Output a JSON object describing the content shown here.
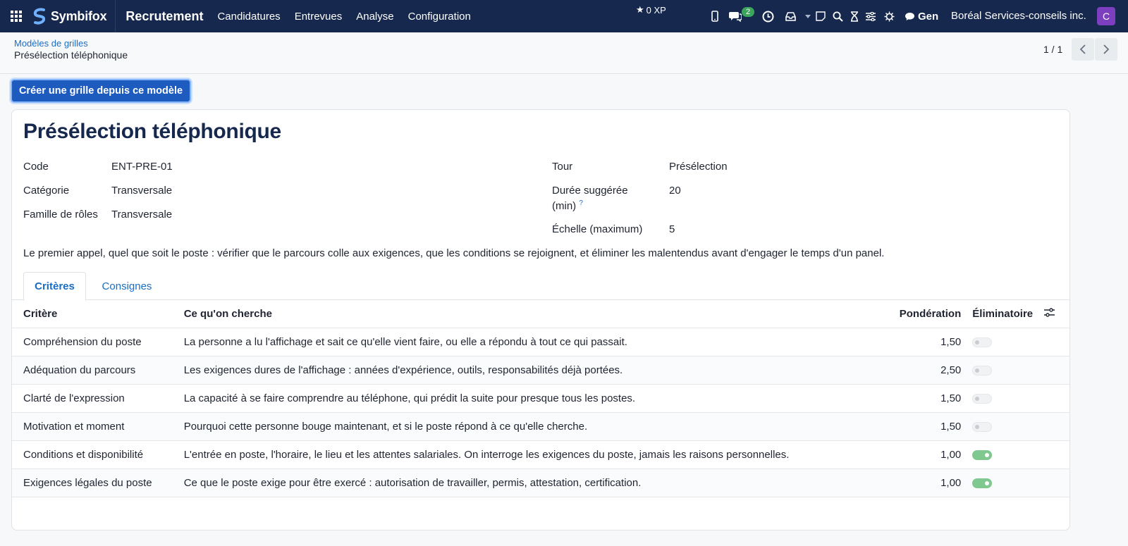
{
  "navbar": {
    "brand": "Symbifox",
    "app_title": "Recrutement",
    "menu": [
      "Candidatures",
      "Entrevues",
      "Analyse",
      "Configuration"
    ],
    "xp": "0 XP",
    "chat_badge": "2",
    "lang": "Gen",
    "company": "Boréal Services-conseils inc.",
    "avatar_letter": "C"
  },
  "breadcrumb": {
    "parent": "Modèles de grilles",
    "current": "Présélection téléphonique"
  },
  "pager": {
    "value": "1 / 1"
  },
  "actions": {
    "create_label": "Créer une grille depuis ce modèle"
  },
  "form": {
    "title": "Présélection téléphonique",
    "left_fields": [
      {
        "label": "Code",
        "value": "ENT-PRE-01"
      },
      {
        "label": "Catégorie",
        "value": "Transversale"
      },
      {
        "label": "Famille de rôles",
        "value": "Transversale"
      }
    ],
    "right_fields": [
      {
        "label": "Tour",
        "value": "Présélection"
      },
      {
        "label_line1": "Durée suggérée",
        "label_line2": "(min)",
        "help": "?",
        "value": "20"
      },
      {
        "label": "Échelle (maximum)",
        "value": "5"
      }
    ],
    "description": "Le premier appel, quel que soit le poste : vérifier que le parcours colle aux exigences, que les conditions se rejoignent, et éliminer les malentendus avant d'engager le temps d'un panel."
  },
  "tabs": [
    {
      "label": "Critères",
      "active": true
    },
    {
      "label": "Consignes",
      "active": false
    }
  ],
  "table": {
    "headers": [
      "Critère",
      "Ce qu'on cherche",
      "Pondération",
      "Éliminatoire"
    ],
    "rows": [
      {
        "critere": "Compréhension du poste",
        "cherche": "La personne a lu l'affichage et sait ce qu'elle vient faire, ou elle a répondu à tout ce qui passait.",
        "ponderation": "1,50",
        "eliminatoire": false
      },
      {
        "critere": "Adéquation du parcours",
        "cherche": "Les exigences dures de l'affichage : années d'expérience, outils, responsabilités déjà portées.",
        "ponderation": "2,50",
        "eliminatoire": false
      },
      {
        "critere": "Clarté de l'expression",
        "cherche": "La capacité à se faire comprendre au téléphone, qui prédit la suite pour presque tous les postes.",
        "ponderation": "1,50",
        "eliminatoire": false
      },
      {
        "critere": "Motivation et moment",
        "cherche": "Pourquoi cette personne bouge maintenant, et si le poste répond à ce qu'elle cherche.",
        "ponderation": "1,50",
        "eliminatoire": false
      },
      {
        "critere": "Conditions et disponibilité",
        "cherche": "L'entrée en poste, l'horaire, le lieu et les attentes salariales. On interroge les exigences du poste, jamais les raisons personnelles.",
        "ponderation": "1,00",
        "eliminatoire": true
      },
      {
        "critere": "Exigences légales du poste",
        "cherche": "Ce que le poste exige pour être exercé : autorisation de travailler, permis, attestation, certification.",
        "ponderation": "1,00",
        "eliminatoire": true
      }
    ]
  }
}
